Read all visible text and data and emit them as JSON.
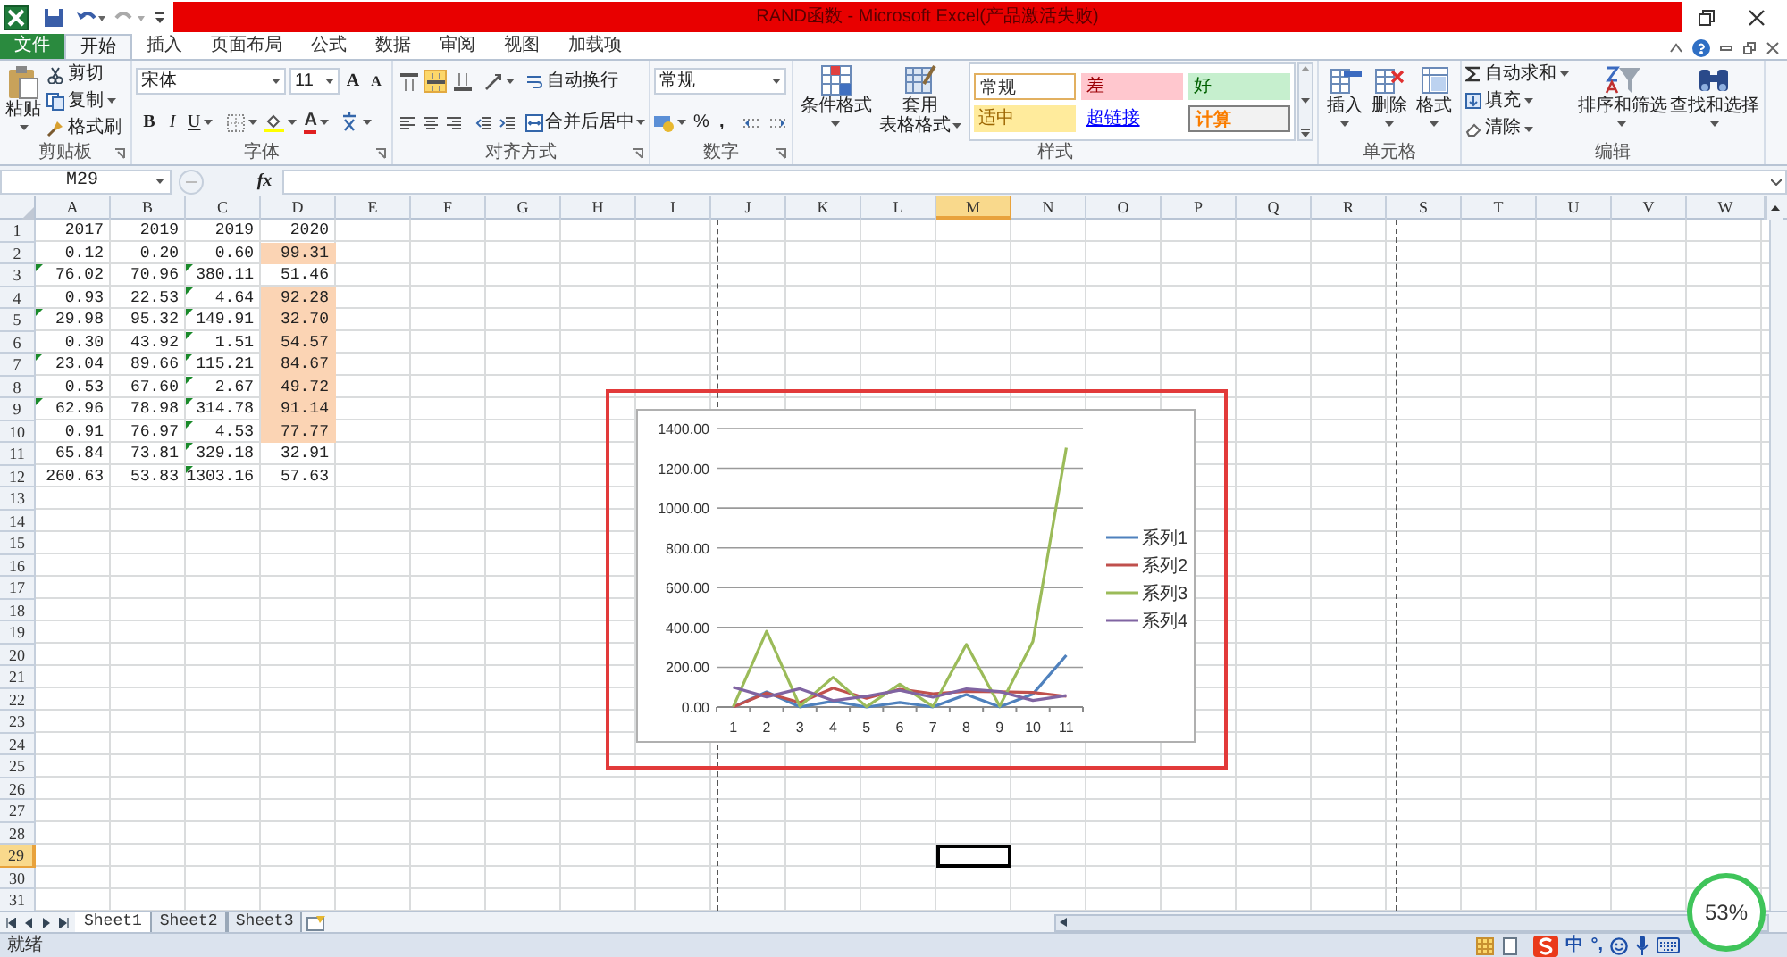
{
  "window": {
    "title": "RAND函数 - Microsoft Excel(产品激活失败)"
  },
  "tabs": [
    {
      "label": "文件",
      "kind": "file",
      "selected": false
    },
    {
      "label": "开始",
      "kind": "tab",
      "selected": true
    },
    {
      "label": "插入",
      "kind": "tab",
      "selected": false
    },
    {
      "label": "页面布局",
      "kind": "tab",
      "selected": false
    },
    {
      "label": "公式",
      "kind": "tab",
      "selected": false
    },
    {
      "label": "数据",
      "kind": "tab",
      "selected": false
    },
    {
      "label": "审阅",
      "kind": "tab",
      "selected": false
    },
    {
      "label": "视图",
      "kind": "tab",
      "selected": false
    },
    {
      "label": "加载项",
      "kind": "tab",
      "selected": false
    }
  ],
  "ribbon": {
    "clipboard": {
      "label": "剪贴板",
      "paste": "粘贴",
      "cut": "剪切",
      "copy": "复制",
      "format_painter": "格式刷"
    },
    "font": {
      "label": "字体",
      "name": "宋体",
      "size": "11",
      "grow": "A",
      "shrink": "A",
      "bold": "B",
      "italic": "I",
      "underline": "U",
      "swatch_label": "A"
    },
    "alignment": {
      "label": "对齐方式",
      "wrap": "自动换行",
      "merge": "合并后居中",
      "vertical": [
        {
          "selected": false
        },
        {
          "selected": true
        },
        {
          "selected": false
        }
      ]
    },
    "number": {
      "label": "数字",
      "format": "常规",
      "percent": "%",
      "comma": ","
    },
    "styles": {
      "label": "样式",
      "conditional": "条件格式",
      "table_line1": "套用",
      "table_line2": "表格格式",
      "cell_styles": [
        {
          "label": "常规",
          "kind": "normal"
        },
        {
          "label": "差",
          "kind": "bad"
        },
        {
          "label": "好",
          "kind": "good"
        },
        {
          "label": "适中",
          "kind": "neutral"
        },
        {
          "label": "超链接",
          "kind": "hyperlink"
        },
        {
          "label": "计算",
          "kind": "calculation"
        }
      ]
    },
    "cells": {
      "label": "单元格",
      "insert": "插入",
      "delete": "删除",
      "format": "格式"
    },
    "editing": {
      "label": "编辑",
      "autosum": "自动求和",
      "fill": "填充",
      "clear": "清除",
      "sort": "排序和筛选",
      "find": "查找和选择"
    }
  },
  "formula_bar": {
    "name_box": "M29",
    "function_label": "fx"
  },
  "sheet": {
    "columns": [
      {
        "label": "A",
        "selected": false
      },
      {
        "label": "B",
        "selected": false
      },
      {
        "label": "C",
        "selected": false
      },
      {
        "label": "D",
        "selected": false
      },
      {
        "label": "E",
        "selected": false
      },
      {
        "label": "F",
        "selected": false
      },
      {
        "label": "G",
        "selected": false
      },
      {
        "label": "H",
        "selected": false
      },
      {
        "label": "I",
        "selected": false
      },
      {
        "label": "J",
        "selected": false
      },
      {
        "label": "K",
        "selected": false
      },
      {
        "label": "L",
        "selected": false
      },
      {
        "label": "M",
        "selected": true
      },
      {
        "label": "N",
        "selected": false
      },
      {
        "label": "O",
        "selected": false
      },
      {
        "label": "P",
        "selected": false
      },
      {
        "label": "Q",
        "selected": false
      },
      {
        "label": "R",
        "selected": false
      },
      {
        "label": "S",
        "selected": false
      },
      {
        "label": "T",
        "selected": false
      },
      {
        "label": "U",
        "selected": false
      },
      {
        "label": "V",
        "selected": false
      },
      {
        "label": "W",
        "selected": false
      }
    ],
    "rows": [
      {
        "label": "1",
        "selected": false,
        "cells": [
          {
            "value": "2017",
            "flagged": false,
            "highlighted": false
          },
          {
            "value": "2019",
            "flagged": false,
            "highlighted": false
          },
          {
            "value": "2019",
            "flagged": false,
            "highlighted": false
          },
          {
            "value": "2020",
            "flagged": false,
            "highlighted": false
          }
        ]
      },
      {
        "label": "2",
        "selected": false,
        "cells": [
          {
            "value": "0.12",
            "flagged": false,
            "highlighted": false
          },
          {
            "value": "0.20",
            "flagged": false,
            "highlighted": false
          },
          {
            "value": "0.60",
            "flagged": false,
            "highlighted": false
          },
          {
            "value": "99.31",
            "flagged": false,
            "highlighted": true
          }
        ]
      },
      {
        "label": "3",
        "selected": false,
        "cells": [
          {
            "value": "76.02",
            "flagged": true,
            "highlighted": false
          },
          {
            "value": "70.96",
            "flagged": false,
            "highlighted": false
          },
          {
            "value": "380.11",
            "flagged": true,
            "highlighted": false
          },
          {
            "value": "51.46",
            "flagged": false,
            "highlighted": false
          }
        ]
      },
      {
        "label": "4",
        "selected": false,
        "cells": [
          {
            "value": "0.93",
            "flagged": false,
            "highlighted": false
          },
          {
            "value": "22.53",
            "flagged": false,
            "highlighted": false
          },
          {
            "value": "4.64",
            "flagged": true,
            "highlighted": false
          },
          {
            "value": "92.28",
            "flagged": false,
            "highlighted": true
          }
        ]
      },
      {
        "label": "5",
        "selected": false,
        "cells": [
          {
            "value": "29.98",
            "flagged": true,
            "highlighted": false
          },
          {
            "value": "95.32",
            "flagged": false,
            "highlighted": false
          },
          {
            "value": "149.91",
            "flagged": true,
            "highlighted": false
          },
          {
            "value": "32.70",
            "flagged": false,
            "highlighted": true
          }
        ]
      },
      {
        "label": "6",
        "selected": false,
        "cells": [
          {
            "value": "0.30",
            "flagged": false,
            "highlighted": false
          },
          {
            "value": "43.92",
            "flagged": false,
            "highlighted": false
          },
          {
            "value": "1.51",
            "flagged": true,
            "highlighted": false
          },
          {
            "value": "54.57",
            "flagged": false,
            "highlighted": true
          }
        ]
      },
      {
        "label": "7",
        "selected": false,
        "cells": [
          {
            "value": "23.04",
            "flagged": true,
            "highlighted": false
          },
          {
            "value": "89.66",
            "flagged": false,
            "highlighted": false
          },
          {
            "value": "115.21",
            "flagged": true,
            "highlighted": false
          },
          {
            "value": "84.67",
            "flagged": false,
            "highlighted": true
          }
        ]
      },
      {
        "label": "8",
        "selected": false,
        "cells": [
          {
            "value": "0.53",
            "flagged": false,
            "highlighted": false
          },
          {
            "value": "67.60",
            "flagged": false,
            "highlighted": false
          },
          {
            "value": "2.67",
            "flagged": true,
            "highlighted": false
          },
          {
            "value": "49.72",
            "flagged": false,
            "highlighted": true
          }
        ]
      },
      {
        "label": "9",
        "selected": false,
        "cells": [
          {
            "value": "62.96",
            "flagged": true,
            "highlighted": false
          },
          {
            "value": "78.98",
            "flagged": false,
            "highlighted": false
          },
          {
            "value": "314.78",
            "flagged": true,
            "highlighted": false
          },
          {
            "value": "91.14",
            "flagged": false,
            "highlighted": true
          }
        ]
      },
      {
        "label": "10",
        "selected": false,
        "cells": [
          {
            "value": "0.91",
            "flagged": false,
            "highlighted": false
          },
          {
            "value": "76.97",
            "flagged": false,
            "highlighted": false
          },
          {
            "value": "4.53",
            "flagged": true,
            "highlighted": false
          },
          {
            "value": "77.77",
            "flagged": false,
            "highlighted": true
          }
        ]
      },
      {
        "label": "11",
        "selected": false,
        "cells": [
          {
            "value": "65.84",
            "flagged": false,
            "highlighted": false
          },
          {
            "value": "73.81",
            "flagged": false,
            "highlighted": false
          },
          {
            "value": "329.18",
            "flagged": true,
            "highlighted": false
          },
          {
            "value": "32.91",
            "flagged": false,
            "highlighted": false
          }
        ]
      },
      {
        "label": "12",
        "selected": false,
        "cells": [
          {
            "value": "260.63",
            "flagged": false,
            "highlighted": false
          },
          {
            "value": "53.83",
            "flagged": false,
            "highlighted": false
          },
          {
            "value": "1303.16",
            "flagged": true,
            "highlighted": false
          },
          {
            "value": "57.63",
            "flagged": false,
            "highlighted": false
          }
        ]
      },
      {
        "label": "13",
        "selected": false
      },
      {
        "label": "14",
        "selected": false
      },
      {
        "label": "15",
        "selected": false
      },
      {
        "label": "16",
        "selected": false
      },
      {
        "label": "17",
        "selected": false
      },
      {
        "label": "18",
        "selected": false
      },
      {
        "label": "19",
        "selected": false
      },
      {
        "label": "20",
        "selected": false
      },
      {
        "label": "21",
        "selected": false
      },
      {
        "label": "22",
        "selected": false
      },
      {
        "label": "23",
        "selected": false
      },
      {
        "label": "24",
        "selected": false
      },
      {
        "label": "25",
        "selected": false
      },
      {
        "label": "26",
        "selected": false
      },
      {
        "label": "27",
        "selected": false
      },
      {
        "label": "28",
        "selected": false
      },
      {
        "label": "29",
        "selected": true
      },
      {
        "label": "30",
        "selected": false
      },
      {
        "label": "31",
        "selected": false
      }
    ]
  },
  "chart": {
    "chart_data": {
      "type": "line",
      "categories": [
        "1",
        "2",
        "3",
        "4",
        "5",
        "6",
        "7",
        "8",
        "9",
        "10",
        "11"
      ],
      "series": [
        {
          "name": "系列1",
          "color": "#4f81bd",
          "values": [
            0.12,
            76.02,
            0.93,
            29.98,
            0.3,
            23.04,
            0.53,
            62.96,
            0.91,
            65.84,
            260.63
          ]
        },
        {
          "name": "系列2",
          "color": "#c0504d",
          "values": [
            0.2,
            70.96,
            22.53,
            95.32,
            43.92,
            89.66,
            67.6,
            78.98,
            76.97,
            73.81,
            53.83
          ]
        },
        {
          "name": "系列3",
          "color": "#9bbb59",
          "values": [
            0.6,
            380.11,
            4.64,
            149.91,
            1.51,
            115.21,
            2.67,
            314.78,
            4.53,
            329.18,
            1303.16
          ]
        },
        {
          "name": "系列4",
          "color": "#8064a2",
          "values": [
            99.31,
            51.46,
            92.28,
            32.7,
            54.57,
            84.67,
            49.72,
            91.14,
            77.77,
            32.91,
            57.63
          ]
        }
      ],
      "ylim": [
        0,
        1400
      ],
      "grid": true,
      "legend": true,
      "yticks": [
        {
          "value": 0,
          "label": "0.00"
        },
        {
          "value": 200,
          "label": "200.00"
        },
        {
          "value": 400,
          "label": "400.00"
        },
        {
          "value": 600,
          "label": "600.00"
        },
        {
          "value": 800,
          "label": "800.00"
        },
        {
          "value": 1000,
          "label": "1000.00"
        },
        {
          "value": 1200,
          "label": "1200.00"
        },
        {
          "value": 1400,
          "label": "1400.00"
        }
      ]
    }
  },
  "sheet_tabs": [
    {
      "label": "Sheet1",
      "selected": true
    },
    {
      "label": "Sheet2",
      "selected": false
    },
    {
      "label": "Sheet3",
      "selected": false
    }
  ],
  "status_bar": {
    "text": "就绪",
    "ime_mode": "中",
    "ime_punct": "°,"
  },
  "meter": {
    "reading": "53%"
  }
}
